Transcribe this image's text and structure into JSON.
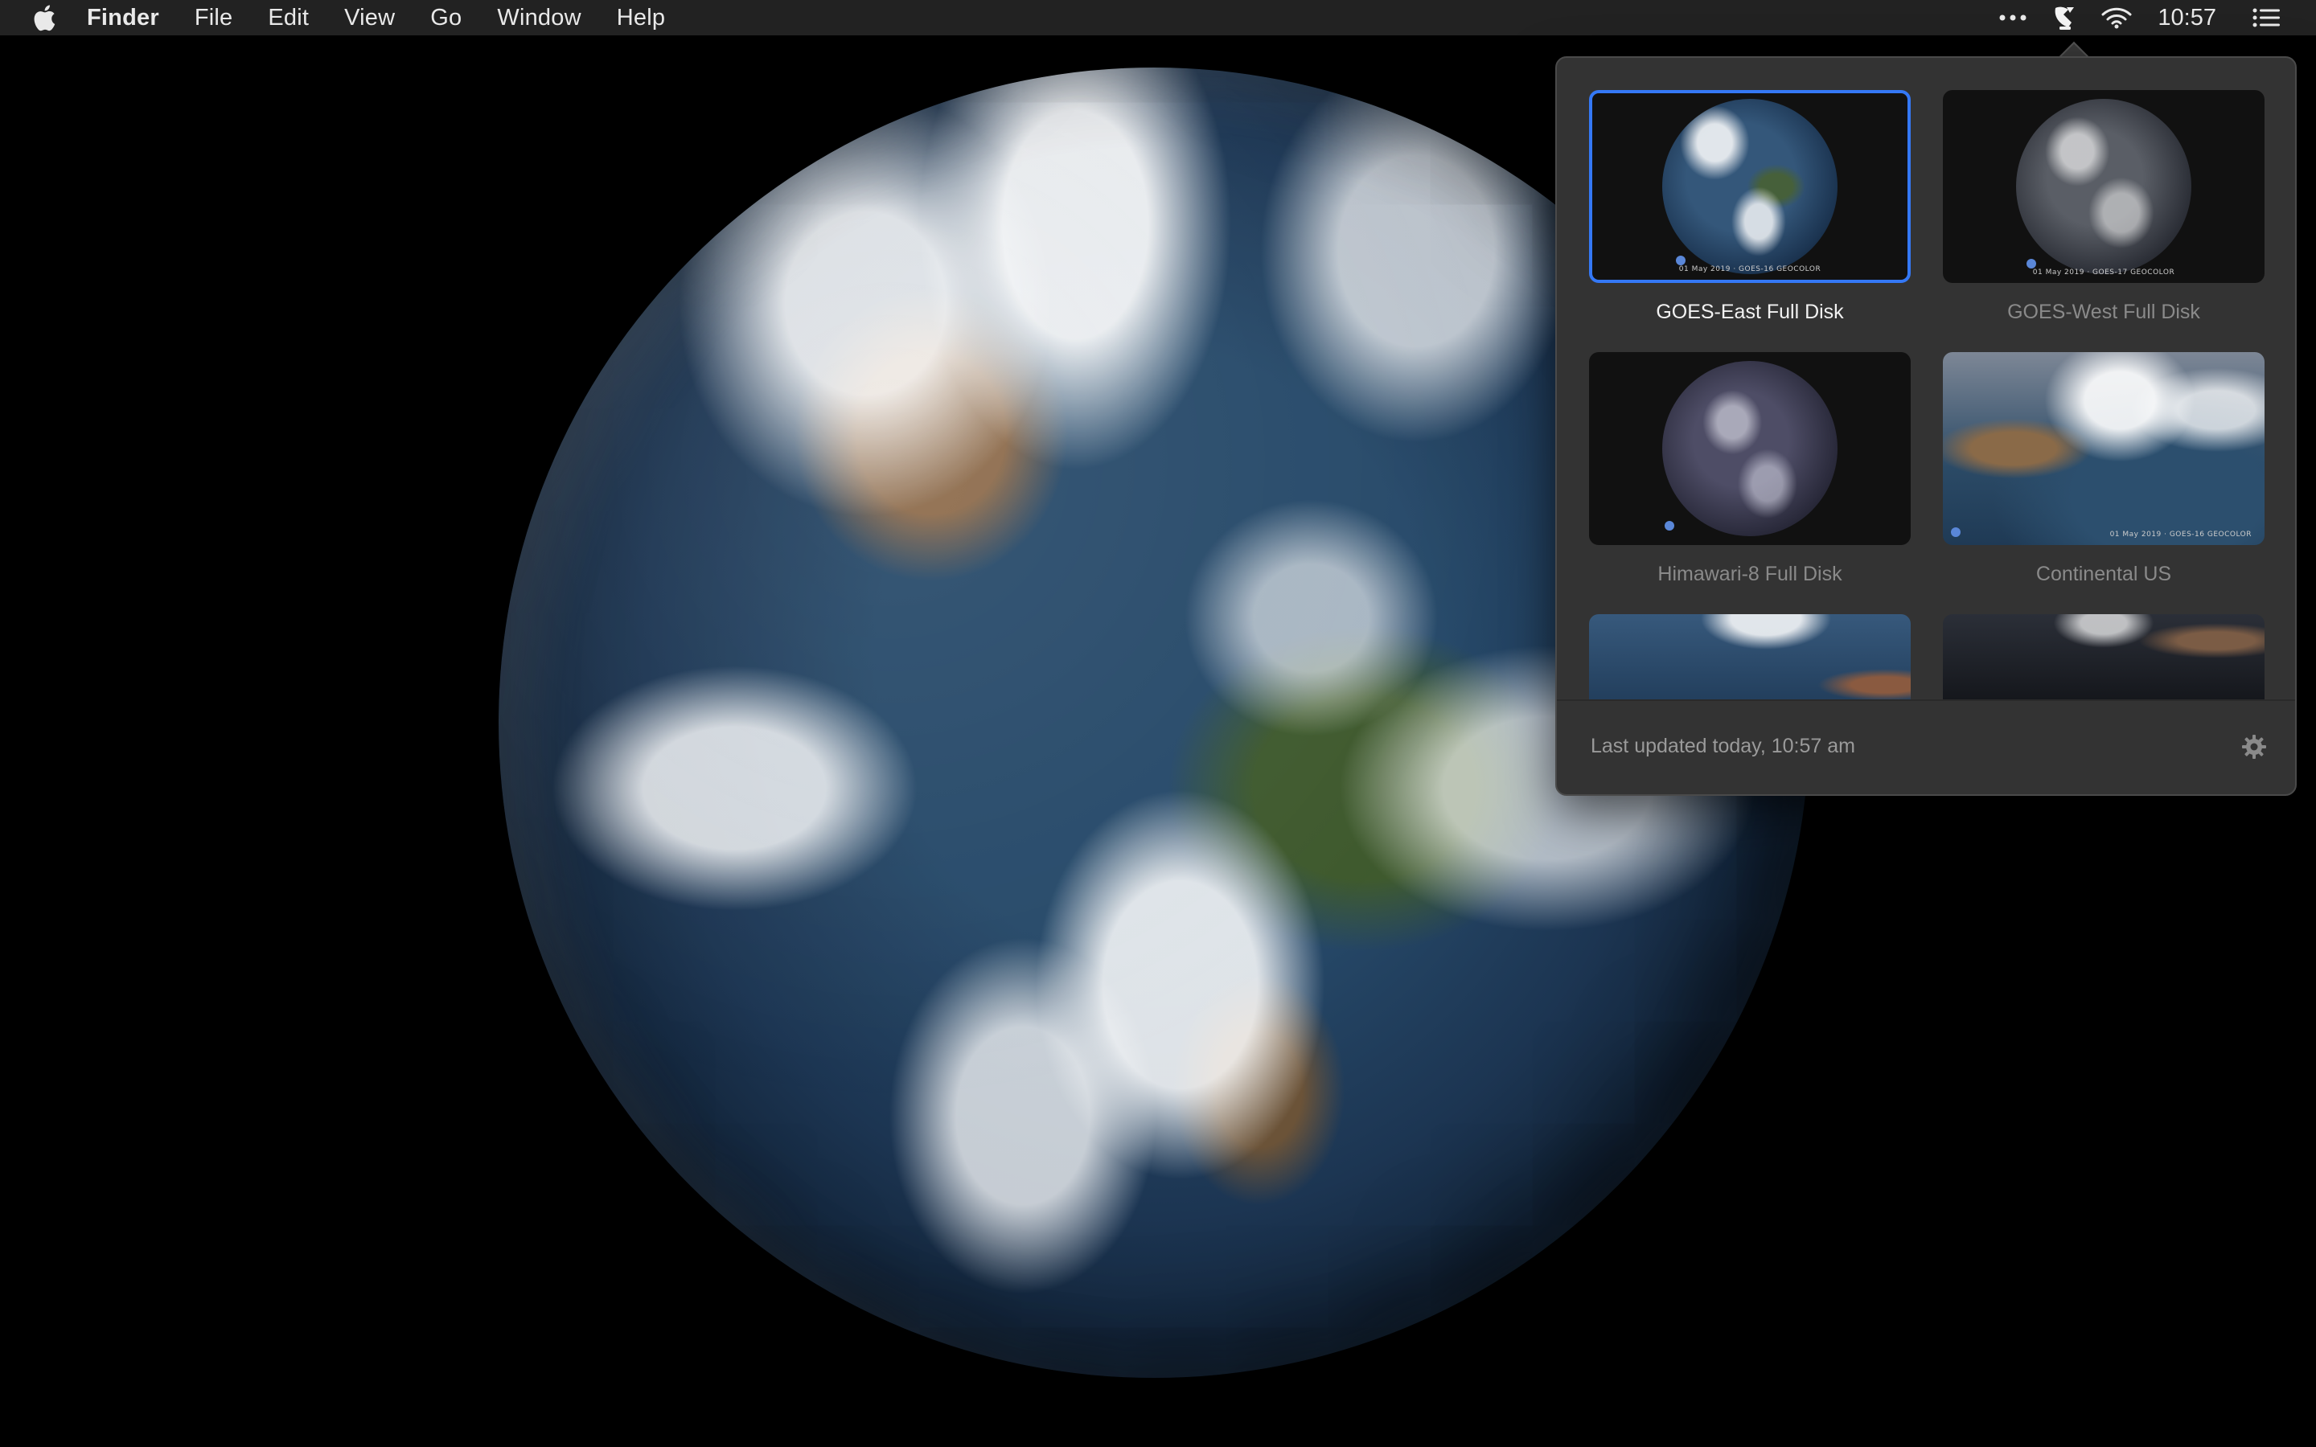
{
  "menubar": {
    "apple_icon": "apple-logo-icon",
    "app_name": "Finder",
    "items": [
      "File",
      "Edit",
      "View",
      "Go",
      "Window",
      "Help"
    ],
    "status": {
      "more_icon": "ellipsis-icon",
      "app_icon": "satellite-dish-icon",
      "wifi_icon": "wifi-icon",
      "clock": "10:57",
      "list_icon": "notification-list-icon"
    }
  },
  "wallpaper": {
    "description_icon": "earth-globe-image"
  },
  "popover": {
    "thumbnails": [
      {
        "label": "GOES-East Full Disk",
        "selected": true,
        "caption": "01 May 2019 · GOES-16 GEOCOLOR"
      },
      {
        "label": "GOES-West Full Disk",
        "selected": false,
        "caption": "01 May 2019 · GOES-17 GEOCOLOR"
      },
      {
        "label": "Himawari-8 Full Disk",
        "selected": false,
        "caption": ""
      },
      {
        "label": "Continental US",
        "selected": false,
        "caption": "01 May 2019 · GOES-16 GEOCOLOR"
      },
      {
        "label": "",
        "selected": false,
        "caption": ""
      },
      {
        "label": "",
        "selected": false,
        "caption": ""
      }
    ],
    "footer": {
      "last_updated": "Last updated today, 10:57 am",
      "settings_icon": "gear-icon"
    },
    "accent_color": "#3478f6"
  }
}
